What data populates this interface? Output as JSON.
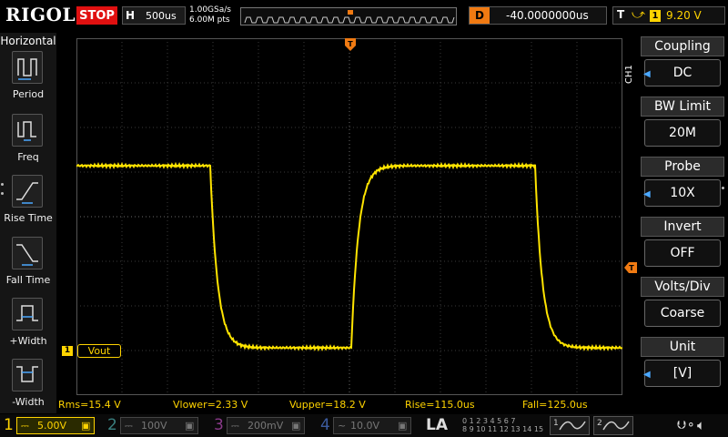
{
  "topbar": {
    "logo": "RIGOL",
    "run_state": "STOP",
    "horizontal_label": "H",
    "timebase": "500us",
    "sample_rate": "1.00GSa/s",
    "memory_depth": "6.00M pts",
    "delay_label": "D",
    "delay_value": "-40.0000000us",
    "trigger_label": "T",
    "trigger_edge_icon": "rising-edge-icon",
    "trigger_source": "1",
    "trigger_level": "9.20 V"
  },
  "left_panel": {
    "title": "Horizontal",
    "items": [
      {
        "label": "Period",
        "icon": "period-icon"
      },
      {
        "label": "Freq",
        "icon": "frequency-icon"
      },
      {
        "label": "Rise Time",
        "icon": "rise-time-icon"
      },
      {
        "label": "Fall Time",
        "icon": "fall-time-icon"
      },
      {
        "label": "+Width",
        "icon": "positive-width-icon"
      },
      {
        "label": "-Width",
        "icon": "negative-width-icon"
      }
    ]
  },
  "channel_marker": {
    "number": "1",
    "label": "Vout"
  },
  "right_panel": {
    "channel_tab": "CH1",
    "items": [
      {
        "label": "Coupling",
        "value": "DC",
        "arrow": true
      },
      {
        "label": "BW Limit",
        "value": "20M",
        "arrow": false
      },
      {
        "label": "Probe",
        "value": "10X",
        "arrow": true
      },
      {
        "label": "Invert",
        "value": "OFF",
        "arrow": false
      },
      {
        "label": "Volts/Div",
        "value": "Coarse",
        "arrow": false
      },
      {
        "label": "Unit",
        "value": "[V]",
        "arrow": true
      }
    ]
  },
  "measurements": {
    "rms": "Rms=15.4 V",
    "vlower": "Vlower=2.33 V",
    "vupper": "Vupper=18.2 V",
    "rise": "Rise=115.0us",
    "fall": "Fall=125.0us"
  },
  "bottombar": {
    "channels": [
      {
        "num": "1",
        "scale": "5.00V",
        "coupling_icon": "dc-coupling-icon",
        "color": "#ffd400",
        "active": true
      },
      {
        "num": "2",
        "scale": "100V",
        "coupling_icon": "dc-coupling-icon",
        "color": "#00c8c8",
        "active": false
      },
      {
        "num": "3",
        "scale": "200mV",
        "coupling_icon": "dc-coupling-icon",
        "color": "#e040e0",
        "active": false
      },
      {
        "num": "4",
        "scale": "10.0V",
        "coupling_icon": "ac-coupling-icon",
        "color": "#3c78ff",
        "active": false
      }
    ],
    "la_label": "LA",
    "digital_rows": [
      "0 1 2 3  4 5 6 7",
      "8 9 10 11  12 13 14 15"
    ],
    "decode_buttons": [
      "1",
      "2"
    ],
    "usb_icon": "usb-icon",
    "speaker_icon": "speaker-mute-icon"
  },
  "colors": {
    "ch1": "#ffd400",
    "stop": "#e01010",
    "delay": "#f07a12",
    "accent_blue": "#4aa8ff"
  }
}
